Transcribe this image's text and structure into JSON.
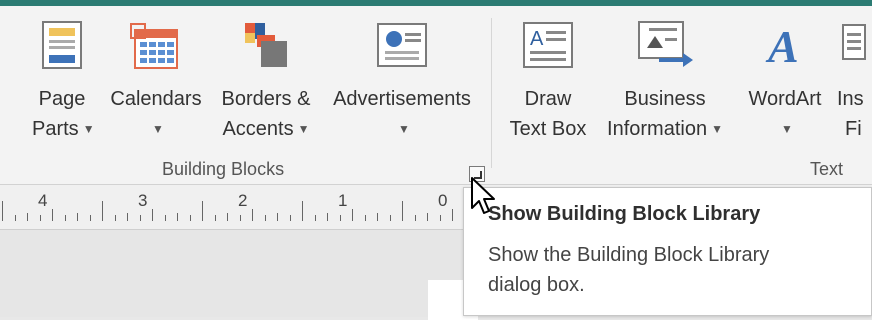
{
  "ribbon": {
    "accent_color": "#2b7b73",
    "groups": [
      {
        "label": "Building Blocks",
        "buttons": [
          {
            "line1": "Page",
            "line2": "Parts",
            "icon": "page-parts-icon"
          },
          {
            "line1": "Calendars",
            "line2": "",
            "icon": "calendar-icon"
          },
          {
            "line1": "Borders &",
            "line2": "Accents",
            "icon": "borders-accents-icon"
          },
          {
            "line1": "Advertisements",
            "line2": "",
            "icon": "advertisement-icon"
          }
        ]
      },
      {
        "label": "Text",
        "buttons": [
          {
            "line1": "Draw",
            "line2": "Text Box",
            "icon": "text-box-icon"
          },
          {
            "line1": "Business",
            "line2": "Information",
            "icon": "business-information-icon"
          },
          {
            "line1": "WordArt",
            "line2": "",
            "icon": "wordart-icon"
          },
          {
            "line1": "Ins",
            "line2": "Fi",
            "icon": "insert-file-icon"
          }
        ]
      }
    ]
  },
  "ruler": {
    "labels": [
      "4",
      "3",
      "2",
      "1",
      "0"
    ]
  },
  "tooltip": {
    "title": "Show Building Block Library",
    "body": "Show the Building Block Library dialog box."
  }
}
